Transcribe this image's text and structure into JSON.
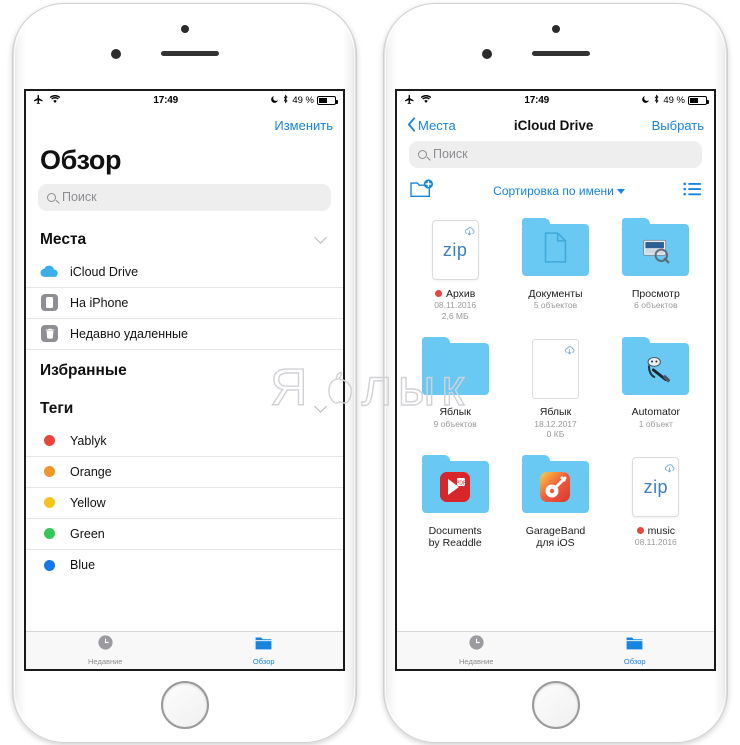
{
  "status_bar": {
    "airplane_icon": "airplane-icon",
    "wifi_icon": "wifi-icon",
    "time": "17:49",
    "dnd_icon": "moon-icon",
    "bluetooth_icon": "bluetooth-icon",
    "battery_percent": "49 %",
    "battery_icon": "battery-icon"
  },
  "colors": {
    "accent": "#1784e0",
    "folder": "#69c9f3",
    "tag_red": "#e8453c",
    "tag_orange": "#f0962a",
    "tag_yellow": "#f5c41c",
    "tag_green": "#35c759",
    "tag_blue": "#1676e8",
    "inactive": "#8e8e93"
  },
  "left_phone": {
    "nav": {
      "edit_label": "Изменить"
    },
    "title": "Обзор",
    "search": {
      "placeholder": "Поиск",
      "icon": "search-icon"
    },
    "sections": [
      {
        "title": "Места",
        "collapsible": true,
        "items": [
          {
            "label": "iCloud Drive",
            "icon": "icloud-icon"
          },
          {
            "label": "На iPhone",
            "icon": "iphone-icon"
          },
          {
            "label": "Недавно удаленные",
            "icon": "trash-icon"
          }
        ]
      },
      {
        "title": "Избранные",
        "collapsible": false,
        "items": []
      },
      {
        "title": "Теги",
        "collapsible": true,
        "items": [
          {
            "label": "Yablyk",
            "color": "#e8453c"
          },
          {
            "label": "Orange",
            "color": "#f0962a"
          },
          {
            "label": "Yellow",
            "color": "#f5c41c"
          },
          {
            "label": "Green",
            "color": "#35c759"
          },
          {
            "label": "Blue",
            "color": "#1676e8"
          }
        ]
      }
    ]
  },
  "right_phone": {
    "nav": {
      "back_label": "Места",
      "back_icon": "chevron-left-icon",
      "title": "iCloud Drive",
      "select_label": "Выбрать"
    },
    "search": {
      "placeholder": "Поиск",
      "icon": "search-icon"
    },
    "toolbar": {
      "new_folder_icon": "new-folder-icon",
      "sort_label": "Сортировка по имени",
      "sort_caret_icon": "caret-down-icon",
      "list_view_icon": "list-view-icon"
    },
    "files": [
      {
        "name": "Архив",
        "type": "zip",
        "tag_color": "#e8453c",
        "sub1": "08.11.2016",
        "sub2": "2,6 МБ",
        "cloud": true,
        "zip_label": "zip"
      },
      {
        "name": "Документы",
        "type": "folder",
        "glyph": "document-icon",
        "sub1": "5 объектов"
      },
      {
        "name": "Просмотр",
        "type": "folder",
        "glyph": "preview-icon",
        "sub1": "6 объектов"
      },
      {
        "name": "Яблык",
        "type": "folder",
        "glyph": "",
        "sub1": "9 объектов"
      },
      {
        "name": "Яблык",
        "type": "file",
        "sub1": "18.12.2017",
        "sub2": "0 КБ",
        "cloud": true
      },
      {
        "name": "Automator",
        "type": "folder",
        "glyph": "automator-icon",
        "sub1": "1 объект"
      },
      {
        "name": "Documents",
        "name2": "by Readdle",
        "type": "folder",
        "glyph": "documents-readdle-icon"
      },
      {
        "name": "GarageBand",
        "name2": "для iOS",
        "type": "folder",
        "glyph": "garageband-icon"
      },
      {
        "name": "music",
        "type": "zip",
        "tag_color": "#e8453c",
        "sub1": "08.11.2016",
        "cloud": true,
        "zip_label": "zip"
      }
    ]
  },
  "tab_bar": {
    "tabs": [
      {
        "label": "Недавние",
        "icon": "clock-icon",
        "active": false
      },
      {
        "label": "Обзор",
        "icon": "folder-icon",
        "active": true
      }
    ]
  },
  "watermark": {
    "text_before": "Я",
    "text_after": "лык",
    "apple_icon": "apple-logo-icon"
  }
}
